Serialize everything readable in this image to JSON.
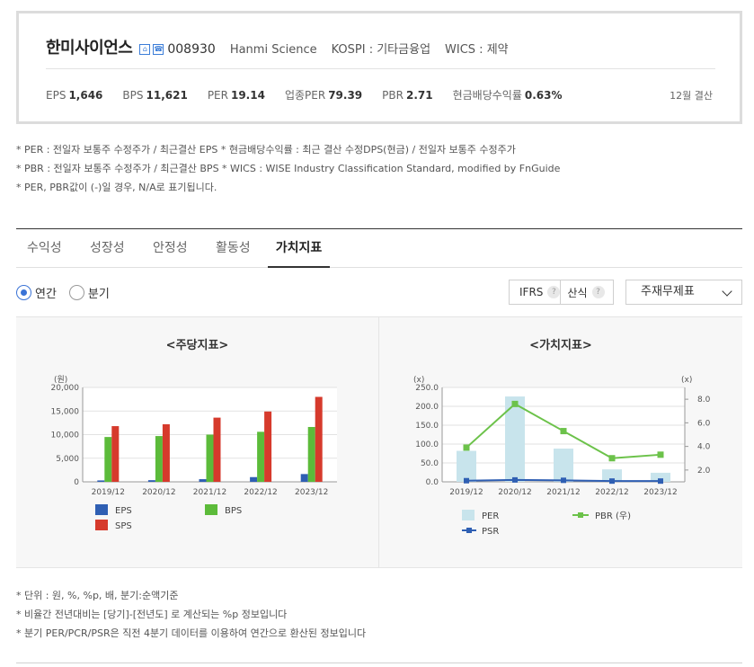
{
  "company": {
    "name": "한미사이언스",
    "code": "008930",
    "eng_name": "Hanmi Science",
    "market": "KOSPI : 기타금융업",
    "wics": "WICS : 제약",
    "icons": [
      "home-icon",
      "phone-icon"
    ]
  },
  "metrics": [
    {
      "label": "EPS",
      "value": "1,646"
    },
    {
      "label": "BPS",
      "value": "11,621"
    },
    {
      "label": "PER",
      "value": "19.14"
    },
    {
      "label": "업종PER",
      "value": "79.39"
    },
    {
      "label": "PBR",
      "value": "2.71"
    },
    {
      "label": "현금배당수익률",
      "value": "0.63%"
    }
  ],
  "settlement": "12월 결산",
  "notes_top": [
    "* PER : 전일자 보통주 수정주가 / 최근결산 EPS * 현금배당수익률 : 최근 결산 수정DPS(현금) / 전일자 보통주 수정주가",
    "* PBR : 전일자 보통주 수정주가 / 최근결산 BPS * WICS : WISE Industry Classification Standard, modified by FnGuide",
    "* PER, PBR값이 (-)일 경우, N/A로 표기됩니다."
  ],
  "tabs": [
    {
      "label": "수익성",
      "active": false
    },
    {
      "label": "성장성",
      "active": false
    },
    {
      "label": "안정성",
      "active": false
    },
    {
      "label": "활동성",
      "active": false
    },
    {
      "label": "가치지표",
      "active": true
    }
  ],
  "period": {
    "options": [
      "연간",
      "분기"
    ],
    "selected": "연간"
  },
  "controls": {
    "ifrs_label": "IFRS",
    "calc_label": "산식",
    "help_glyph": "?",
    "select_value": "주재무제표"
  },
  "colors": {
    "eps": "#2f5fb3",
    "bps": "#5cbb3a",
    "sps": "#d63a2c",
    "per": "#c8e4ec",
    "pbr": "#6cc24a",
    "psr": "#2f5fb3",
    "accent": "#3a73d6"
  },
  "chart_data": [
    {
      "type": "bar",
      "title": "<주당지표>",
      "ylabel": "(원)",
      "ylim": [
        0,
        20000
      ],
      "yticks": [
        "20,000",
        "15,000",
        "10,000",
        "5,000",
        "0"
      ],
      "ytick_values": [
        20000,
        15000,
        10000,
        5000,
        0
      ],
      "categories": [
        "2019/12",
        "2020/12",
        "2021/12",
        "2022/12",
        "2023/12"
      ],
      "series": [
        {
          "name": "EPS",
          "values": [
            300,
            350,
            560,
            1000,
            1646
          ]
        },
        {
          "name": "BPS",
          "values": [
            9500,
            9700,
            10000,
            10600,
            11621
          ]
        },
        {
          "name": "SPS",
          "values": [
            11800,
            12200,
            13600,
            14900,
            18000
          ]
        }
      ],
      "legend": [
        "EPS",
        "BPS",
        "SPS"
      ]
    },
    {
      "type": "bar+line",
      "title": "<가치지표>",
      "ylabel_left": "(x)",
      "ylabel_right": "(x)",
      "ylim_left": [
        0,
        250
      ],
      "ylim_right": [
        1.0,
        9.0
      ],
      "yticks_left": [
        "250.0",
        "200.0",
        "150.0",
        "100.0",
        "50.0",
        "0.0"
      ],
      "yticks_left_values": [
        250,
        200,
        150,
        100,
        50,
        0
      ],
      "yticks_right": [
        "8.0",
        "6.0",
        "4.0",
        "2.0"
      ],
      "yticks_right_values": [
        8,
        6,
        4,
        2
      ],
      "categories": [
        "2019/12",
        "2020/12",
        "2021/12",
        "2022/12",
        "2023/12"
      ],
      "series": [
        {
          "name": "PER",
          "type": "bar",
          "axis": "left",
          "values": [
            82,
            226,
            88,
            33,
            24
          ]
        },
        {
          "name": "PBR (우)",
          "type": "line",
          "axis": "right",
          "values": [
            3.9,
            7.6,
            5.3,
            3.0,
            3.3
          ]
        },
        {
          "name": "PSR",
          "type": "line",
          "axis": "left",
          "values": [
            3,
            5,
            4,
            2,
            2
          ]
        }
      ],
      "legend": [
        "PER",
        "PBR (우)",
        "PSR"
      ]
    }
  ],
  "notes_bottom": [
    "* 단위 : 원, %, %p, 배, 분기:순액기준",
    "* 비율간 전년대비는 [당기]-[전년도] 로 계산되는 %p 정보입니다",
    "* 분기 PER/PCR/PSR은 직전 4분기 데이터를 이용하여 연간으로 환산된 정보입니다"
  ]
}
